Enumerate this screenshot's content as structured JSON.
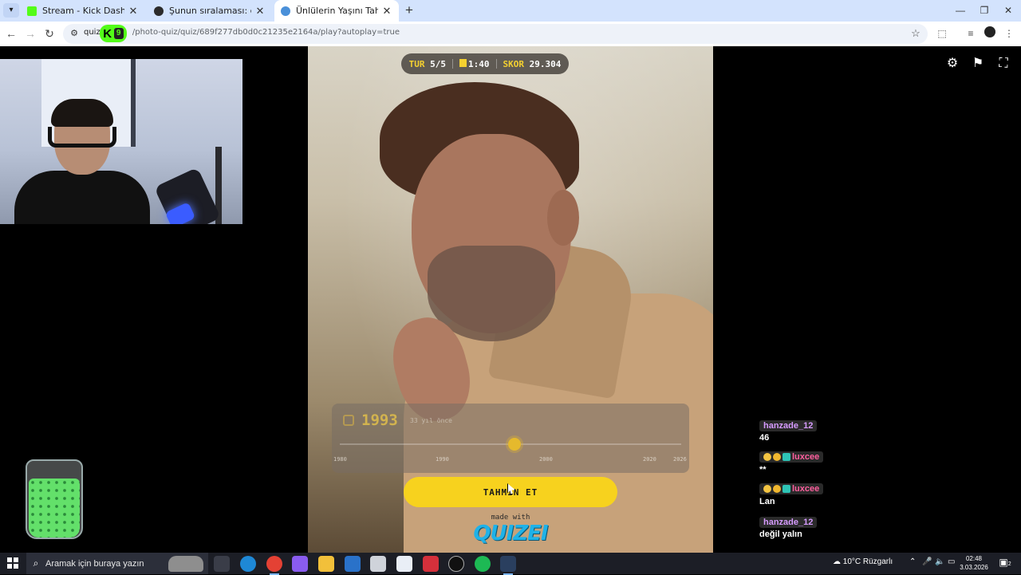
{
  "browser": {
    "tabs": [
      {
        "title": "Stream - Kick Dashboard",
        "favicon_color": "#53fc18",
        "active": false
      },
      {
        "title": "Şunun sıralaması: dharmareal | ",
        "favicon_color": "#2b2b2b",
        "active": false
      },
      {
        "title": "Ünlülerin Yaşını Tahmin Et! - Qu",
        "favicon_color": "#4a90d9",
        "active": true
      }
    ],
    "url_prefix": "quize",
    "url_rest": "/photo-quiz/quiz/689f277db0d0c21235e2164a/play?autoplay=true",
    "kick_badge_letter": "K",
    "kick_badge_count": "9"
  },
  "quiz": {
    "hud": {
      "round_label": "TUR",
      "round_value": "5/5",
      "time_value": "1:40",
      "score_label": "SKOR",
      "score_value": "29.304"
    },
    "guess": {
      "year": "1993",
      "ago": "33 yıl önce",
      "slider_fraction": 0.512,
      "ticks": [
        "1980",
        "1990",
        "2000",
        "2020",
        "2026"
      ]
    },
    "submit_label": "TAHMİN ET",
    "made_with": "made with",
    "brand": "QUIZEI"
  },
  "chat": {
    "messages": [
      {
        "user": "hanzade_12",
        "text": "46",
        "color": "purple"
      },
      {
        "user": "luxcee",
        "text": "**",
        "color": "pink"
      },
      {
        "user": "luxcee",
        "text": "Lan",
        "color": "pink"
      },
      {
        "user": "hanzade_12",
        "text": "değil yalın",
        "color": "purple"
      }
    ]
  },
  "taskbar": {
    "search_placeholder": "Aramak için buraya yazın",
    "weather": "10°C  Rüzgarlı",
    "time": "02:48",
    "date": "3.03.2026",
    "notification_count": "2"
  },
  "colors": {
    "accent_yellow": "#f7d21e",
    "kick_green": "#53fc18",
    "brand_blue": "#1fb2e8"
  }
}
